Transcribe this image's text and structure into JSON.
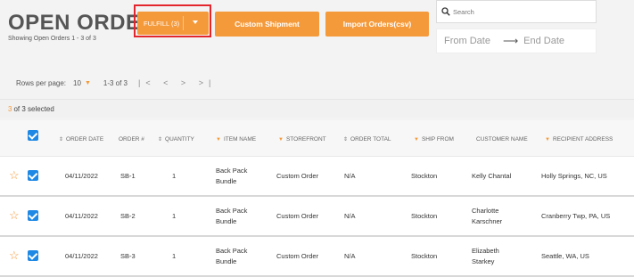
{
  "header": {
    "title": "OPEN ORDERS",
    "subtitle": "Showing Open Orders 1 - 3 of 3",
    "fulfill_label": "FULFILL (3)",
    "custom_shipment_label": "Custom Shipment",
    "import_orders_label": "Import Orders(csv)",
    "search_placeholder": "Search",
    "from_date_placeholder": "From Date",
    "end_date_placeholder": "End Date"
  },
  "pagination": {
    "rows_label": "Rows per page:",
    "rows_value": "10",
    "range": "1-3 of 3"
  },
  "selection": {
    "count": "3",
    "text": "of 3 selected"
  },
  "colors": {
    "accent": "#f59a3b",
    "checkbox": "#1e88e5",
    "highlight_border": "#e3262d"
  },
  "table": {
    "columns": [
      "ORDER DATE",
      "ORDER #",
      "QUANTITY",
      "ITEM NAME",
      "STOREFRONT",
      "ORDER TOTAL",
      "SHIP FROM",
      "CUSTOMER NAME",
      "RECIPIENT ADDRESS"
    ],
    "rows": [
      {
        "date": "04/11/2022",
        "order": "SB-1",
        "qty": "1",
        "item_line1": "Back Pack",
        "item_line2": "Bundle",
        "storefront": "Custom Order",
        "total": "N/A",
        "ship_from": "Stockton",
        "customer_line1": "Kelly Chantal",
        "customer_line2": "",
        "address": "Holly Springs, NC, US"
      },
      {
        "date": "04/11/2022",
        "order": "SB-2",
        "qty": "1",
        "item_line1": "Back Pack",
        "item_line2": "Bundle",
        "storefront": "Custom Order",
        "total": "N/A",
        "ship_from": "Stockton",
        "customer_line1": "Charlotte",
        "customer_line2": "Karschner",
        "address": "Cranberry Twp, PA, US"
      },
      {
        "date": "04/11/2022",
        "order": "SB-3",
        "qty": "1",
        "item_line1": "Back Pack",
        "item_line2": "Bundle",
        "storefront": "Custom Order",
        "total": "N/A",
        "ship_from": "Stockton",
        "customer_line1": "Elizabeth",
        "customer_line2": "Starkey",
        "address": "Seattle, WA, US"
      }
    ]
  }
}
